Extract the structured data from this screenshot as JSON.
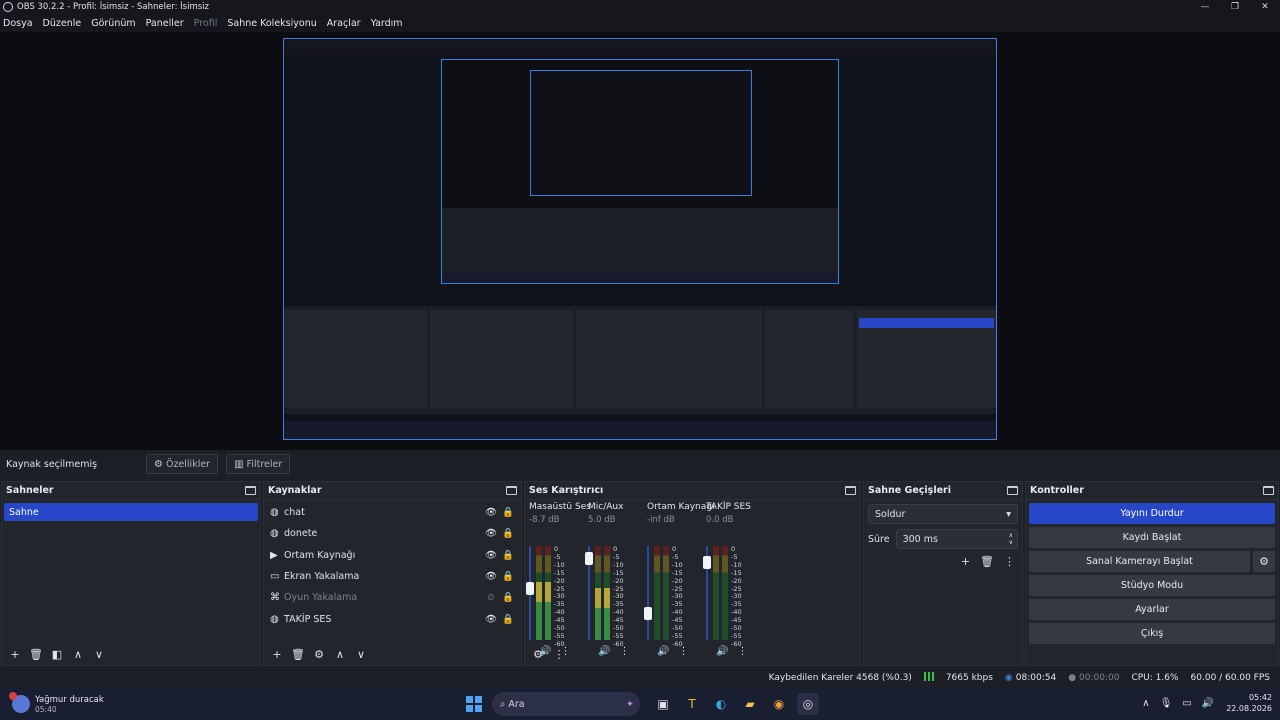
{
  "window": {
    "title": "OBS 30.2.2 - Profil: İsimsiz - Sahneler: İsimsiz"
  },
  "menu": [
    "Dosya",
    "Düzenle",
    "Görünüm",
    "Paneller",
    "Profil",
    "Sahne Koleksiyonu",
    "Araçlar",
    "Yardım"
  ],
  "context_bar": {
    "no_source": "Kaynak seçilmemiş",
    "properties": "Özellikler",
    "filters": "Filtreler"
  },
  "scenes": {
    "title": "Sahneler",
    "items": [
      "Sahne"
    ]
  },
  "sources": {
    "title": "Kaynaklar",
    "items": [
      {
        "icon": "browser-icon",
        "name": "chat",
        "visible": true,
        "locked": true
      },
      {
        "icon": "browser-icon",
        "name": "donete",
        "visible": true,
        "locked": true
      },
      {
        "icon": "media-icon",
        "name": "Ortam Kaynağı",
        "visible": true,
        "locked": true
      },
      {
        "icon": "display-capture-icon",
        "name": "Ekran Yakalama",
        "visible": true,
        "locked": false
      },
      {
        "icon": "game-capture-icon",
        "name": "Oyun Yakalama",
        "visible": false,
        "locked": false
      },
      {
        "icon": "browser-icon",
        "name": "TAKİP SES",
        "visible": true,
        "locked": true
      }
    ]
  },
  "mixer": {
    "title": "Ses Karıştırıcı",
    "scale": [
      "0",
      "-5",
      "-10",
      "-15",
      "-20",
      "-25",
      "-30",
      "-35",
      "-40",
      "-45",
      "-50",
      "-55",
      "-60"
    ],
    "channels": [
      {
        "name": "Masaüstü Ses",
        "db": "-8.7 dB",
        "fader": 0.55,
        "level": 0.62
      },
      {
        "name": "Mic/Aux",
        "db": "5.0 dB",
        "fader": 0.92,
        "level": 0.55
      },
      {
        "name": "Ortam Kaynağı",
        "db": "-inf dB",
        "fader": 0.25,
        "level": 0.0
      },
      {
        "name": "TAKİP SES",
        "db": "0.0 dB",
        "fader": 0.88,
        "level": 0.0
      }
    ]
  },
  "transitions": {
    "title": "Sahne Geçişleri",
    "selected": "Soldur",
    "duration_label": "Süre",
    "duration_value": "300 ms"
  },
  "controls": {
    "title": "Kontroller",
    "buttons": [
      "Yayını Durdur",
      "Kaydı Başlat",
      "Sanal Kamerayı Başlat",
      "Stüdyo Modu",
      "Ayarlar",
      "Çıkış"
    ]
  },
  "status": {
    "dropped": "Kaybedilen Kareler 4568 (%0.3)",
    "bitrate": "7665 kbps",
    "stream_time": "08:00:54",
    "rec_time": "00:00:00",
    "cpu": "CPU: 1.6%",
    "fps": "60.00 / 60.00 FPS"
  },
  "taskbar": {
    "user": "Yağmur duracak",
    "user_time": "05:40",
    "search": "Ara",
    "time": "05:42",
    "date": "22.08.2026"
  },
  "colors": {
    "accent": "#2647c8",
    "preview_border": "#3b7fe0"
  }
}
